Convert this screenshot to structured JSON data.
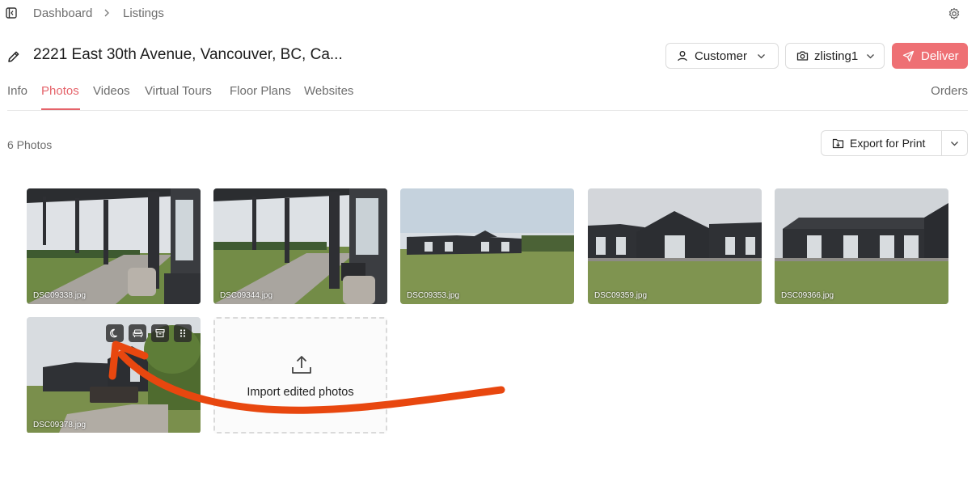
{
  "breadcrumb": {
    "items": [
      "Dashboard",
      "Listings"
    ]
  },
  "listing": {
    "title": "2221 East 30th Avenue, Vancouver, BC, Ca..."
  },
  "header_buttons": {
    "customer": "Customer",
    "listing": "zlisting1",
    "deliver": "Deliver"
  },
  "tabs": [
    {
      "label": "Info"
    },
    {
      "label": "Photos"
    },
    {
      "label": "Videos"
    },
    {
      "label": "Virtual Tours"
    },
    {
      "label": "Floor Plans"
    },
    {
      "label": "Websites"
    }
  ],
  "active_tab": "Photos",
  "orders_label": "Orders",
  "photos": {
    "count_label": "6 Photos",
    "export_label": "Export for Print",
    "items": [
      {
        "filename": "DSC09338.jpg"
      },
      {
        "filename": "DSC09344.jpg"
      },
      {
        "filename": "DSC09353.jpg"
      },
      {
        "filename": "DSC09359.jpg"
      },
      {
        "filename": "DSC09366.jpg"
      },
      {
        "filename": "DSC09378.jpg"
      }
    ],
    "hover_tools": [
      "moon-icon",
      "sofa-icon",
      "archive-icon",
      "drag-handle-icon"
    ],
    "import_label": "Import edited photos"
  },
  "icons": {
    "sidebar_toggle": "sidebar-toggle-icon",
    "breadcrumb_separator": "chevron-right-icon",
    "settings": "gear-icon",
    "edit": "pencil-icon",
    "customer": "user-icon",
    "listing": "camera-icon",
    "deliver": "send-icon",
    "export": "download-icon",
    "import": "upload-icon"
  },
  "colors": {
    "accent": "#e5636a",
    "deliver_bg": "#ee7074",
    "annotation_arrow": "#e8470f"
  }
}
